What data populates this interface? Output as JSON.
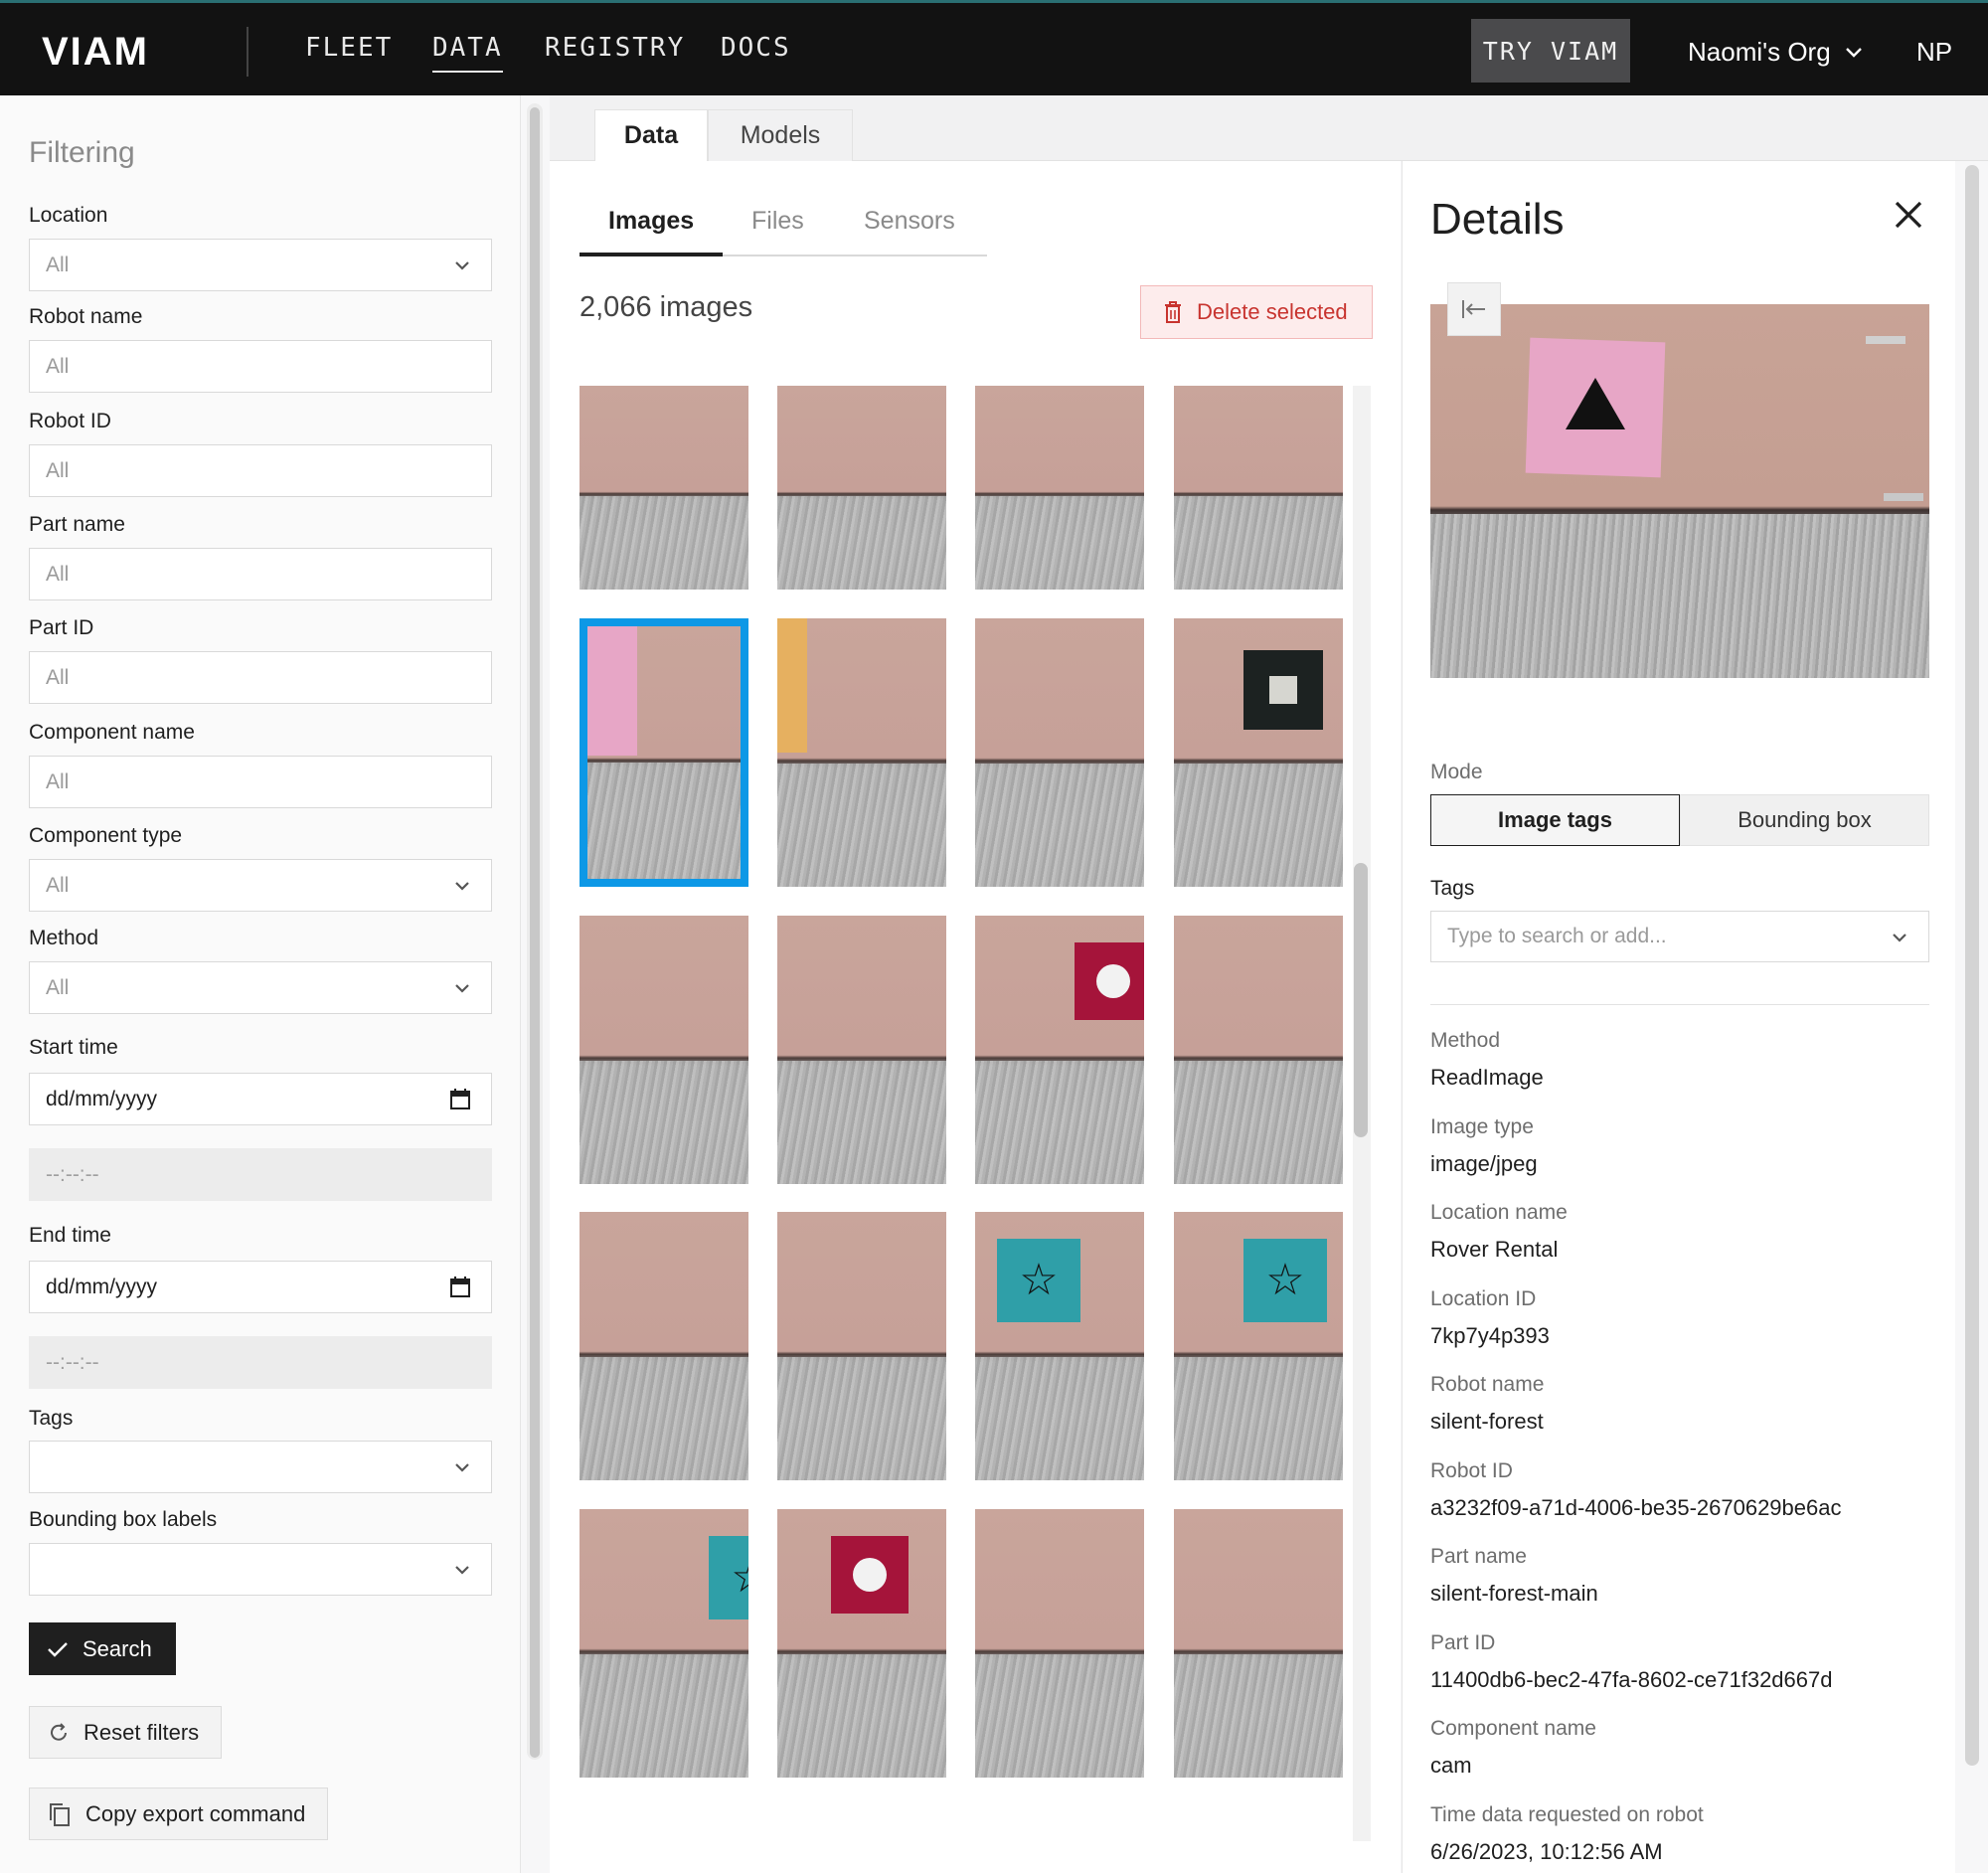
{
  "nav": {
    "logo": "VIAM",
    "links": [
      "FLEET",
      "DATA",
      "REGISTRY",
      "DOCS"
    ],
    "try_label": "TRY VIAM",
    "org_name": "Naomi's Org",
    "avatar_initials": "NP"
  },
  "filters": {
    "title": "Filtering",
    "location": {
      "label": "Location",
      "value": "All"
    },
    "robot_name": {
      "label": "Robot name",
      "placeholder": "All"
    },
    "robot_id": {
      "label": "Robot ID",
      "placeholder": "All"
    },
    "part_name": {
      "label": "Part name",
      "placeholder": "All"
    },
    "part_id": {
      "label": "Part ID",
      "placeholder": "All"
    },
    "component_name": {
      "label": "Component name",
      "placeholder": "All"
    },
    "component_type": {
      "label": "Component type",
      "value": "All"
    },
    "method": {
      "label": "Method",
      "value": "All"
    },
    "start_time": {
      "label": "Start time",
      "date": "dd/mm/yyyy",
      "time": "--:--:--"
    },
    "end_time": {
      "label": "End time",
      "date": "dd/mm/yyyy",
      "time": "--:--:--"
    },
    "tags": {
      "label": "Tags",
      "value": ""
    },
    "bbox_labels": {
      "label": "Bounding box labels",
      "value": ""
    },
    "search_label": "Search",
    "reset_label": "Reset filters",
    "export_label": "Copy export command"
  },
  "main_tabs": [
    "Data",
    "Models"
  ],
  "sub_tabs": [
    "Images",
    "Files",
    "Sensors"
  ],
  "image_count": "2,066 images",
  "delete_label": "Delete selected",
  "grid": {
    "selected_index": 4,
    "signs": [
      "none",
      "none",
      "none",
      "none",
      "triangle-pink",
      "orange-edge",
      "none",
      "square-black",
      "none",
      "none",
      "circle-red",
      "none",
      "none",
      "none",
      "star-teal",
      "star-teal",
      "star-teal-edge",
      "circle-red",
      "none",
      "none"
    ]
  },
  "details": {
    "title": "Details",
    "mode_label": "Mode",
    "modes": [
      "Image tags",
      "Bounding box"
    ],
    "active_mode": "Image tags",
    "tags_label": "Tags",
    "tags_placeholder": "Type to search or add...",
    "fields": [
      {
        "label": "Method",
        "value": "ReadImage"
      },
      {
        "label": "Image type",
        "value": "image/jpeg"
      },
      {
        "label": "Location name",
        "value": "Rover Rental"
      },
      {
        "label": "Location ID",
        "value": "7kp7y4p393"
      },
      {
        "label": "Robot name",
        "value": "silent-forest"
      },
      {
        "label": "Robot ID",
        "value": "a3232f09-a71d-4006-be35-2670629be6ac"
      },
      {
        "label": "Part name",
        "value": "silent-forest-main"
      },
      {
        "label": "Part ID",
        "value": "11400db6-bec2-47fa-8602-ce71f32d667d"
      },
      {
        "label": "Component name",
        "value": "cam"
      },
      {
        "label": "Time data requested on robot",
        "value": "6/26/2023, 10:12:56 AM"
      }
    ]
  },
  "colors": {
    "topbar": "#121212",
    "selected_border": "#0d98e6",
    "delete_text": "#c8342f",
    "sign_pink": "#e7a6c6",
    "sign_teal": "#2f9fa8",
    "sign_red": "#a5143a",
    "sign_orange": "#e6b060"
  }
}
